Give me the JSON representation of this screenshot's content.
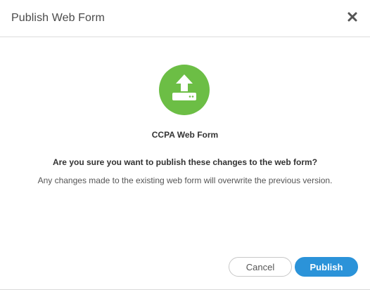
{
  "dialog": {
    "title": "Publish Web Form",
    "close_icon": "close-icon",
    "icon": "upload-icon",
    "icon_color": "#6cbe45",
    "form_name": "CCPA Web Form",
    "question": "Are you sure you want to publish these changes to the web form?",
    "note": "Any changes made to the existing web form will overwrite the previous version."
  },
  "buttons": {
    "cancel_label": "Cancel",
    "publish_label": "Publish",
    "publish_color": "#2b93d9"
  }
}
